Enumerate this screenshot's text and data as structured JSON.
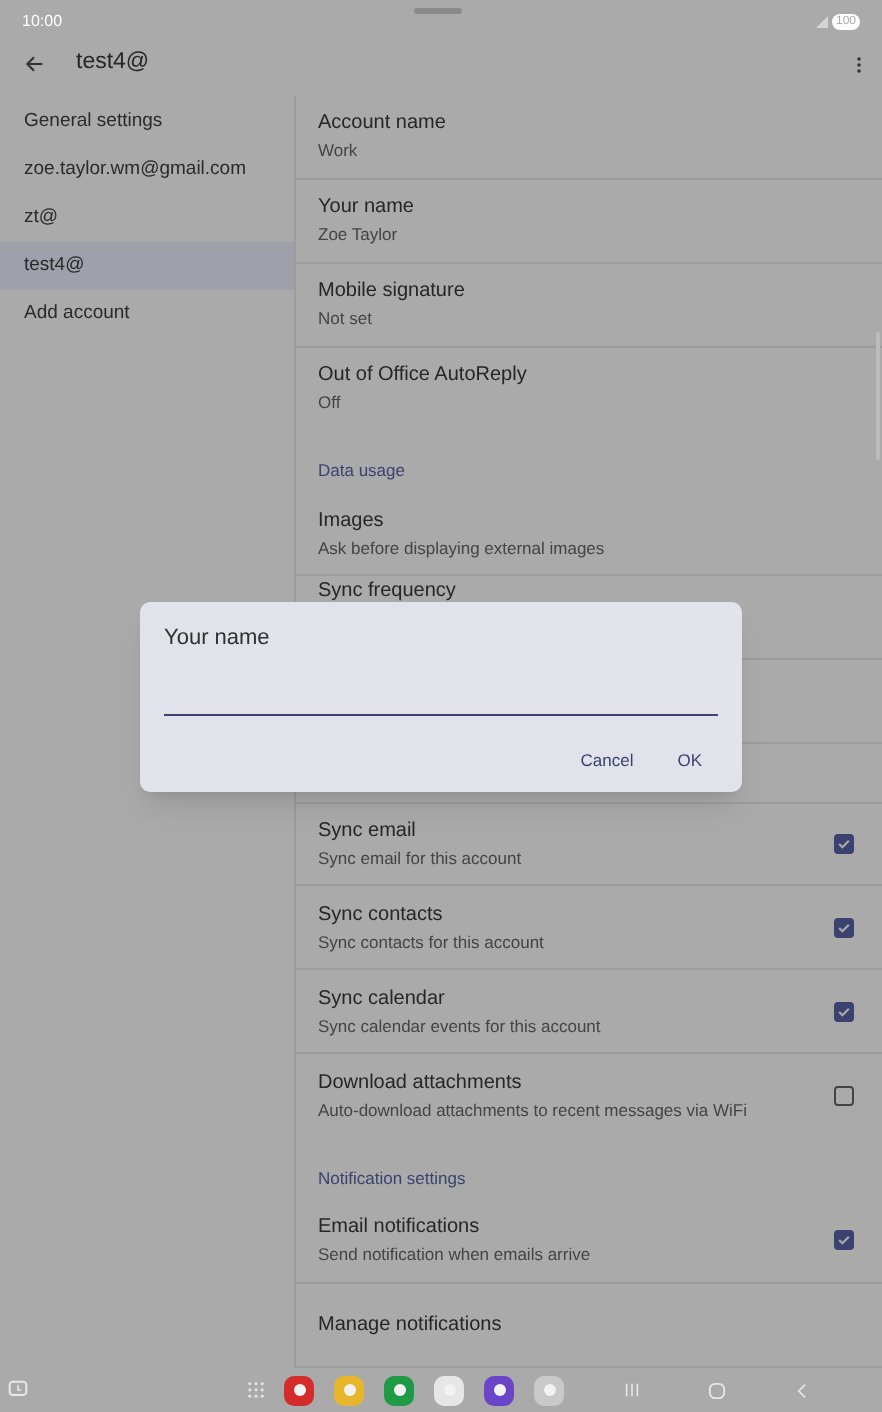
{
  "status_bar": {
    "time": "10:00",
    "battery": "100"
  },
  "toolbar": {
    "title": "test4@"
  },
  "sidebar": {
    "items": [
      {
        "label": "General settings",
        "selected": false
      },
      {
        "label": "zoe.taylor.wm@gmail.com",
        "selected": false
      },
      {
        "label": "zt@",
        "selected": false
      },
      {
        "label": "test4@",
        "selected": true
      },
      {
        "label": "Add account",
        "selected": false
      }
    ]
  },
  "settings": [
    {
      "kind": "item",
      "title": "Account name",
      "subtitle": "Work"
    },
    {
      "kind": "item",
      "title": "Your name",
      "subtitle": "Zoe Taylor"
    },
    {
      "kind": "item",
      "title": "Mobile signature",
      "subtitle": "Not set"
    },
    {
      "kind": "item",
      "title": "Out of Office AutoReply",
      "subtitle": "Off",
      "last": true
    },
    {
      "kind": "header",
      "title": "Data usage"
    },
    {
      "kind": "item",
      "title": "Images",
      "subtitle": "Ask before displaying external images"
    },
    {
      "kind": "item",
      "title": "Sync frequency"
    },
    {
      "kind": "hidden"
    },
    {
      "kind": "hidden"
    },
    {
      "kind": "check",
      "title": "Sync email",
      "subtitle": "Sync email for this account",
      "checked": true
    },
    {
      "kind": "check",
      "title": "Sync contacts",
      "subtitle": "Sync contacts for this account",
      "checked": true
    },
    {
      "kind": "check",
      "title": "Sync calendar",
      "subtitle": "Sync calendar events for this account",
      "checked": true
    },
    {
      "kind": "check",
      "title": "Download attachments",
      "subtitle": "Auto-download attachments to recent messages via WiFi",
      "checked": false,
      "last": true
    },
    {
      "kind": "header",
      "title": "Notification settings"
    },
    {
      "kind": "check",
      "title": "Email notifications",
      "subtitle": "Send notification when emails arrive",
      "checked": true
    },
    {
      "kind": "item",
      "title": "Manage notifications"
    }
  ],
  "dialog": {
    "title": "Your name",
    "buttons": [
      "Cancel",
      "OK"
    ]
  }
}
